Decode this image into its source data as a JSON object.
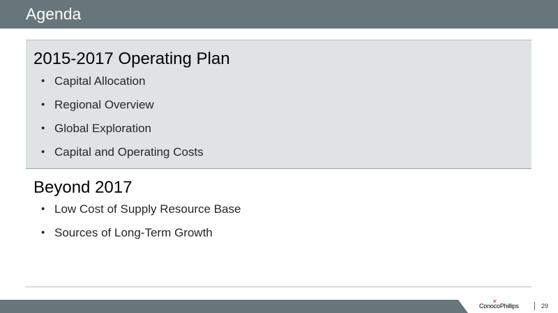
{
  "slide": {
    "title": "Agenda",
    "page_number": "29",
    "logo_text": "ConocoPhillips",
    "logo_mark": "✕"
  },
  "sections": [
    {
      "heading": "2015-2017 Operating Plan",
      "bullets": [
        "Capital Allocation",
        "Regional Overview",
        "Global Exploration",
        "Capital and Operating Costs"
      ]
    },
    {
      "heading": "Beyond 2017",
      "bullets": [
        "Low Cost of Supply Resource Base",
        "Sources of Long-Term Growth"
      ]
    }
  ],
  "bullet_symbol": "•",
  "colors": {
    "title_bar": "#66767b",
    "highlight_band": "#dfe3e4",
    "logo_accent": "#cc1f1f"
  }
}
